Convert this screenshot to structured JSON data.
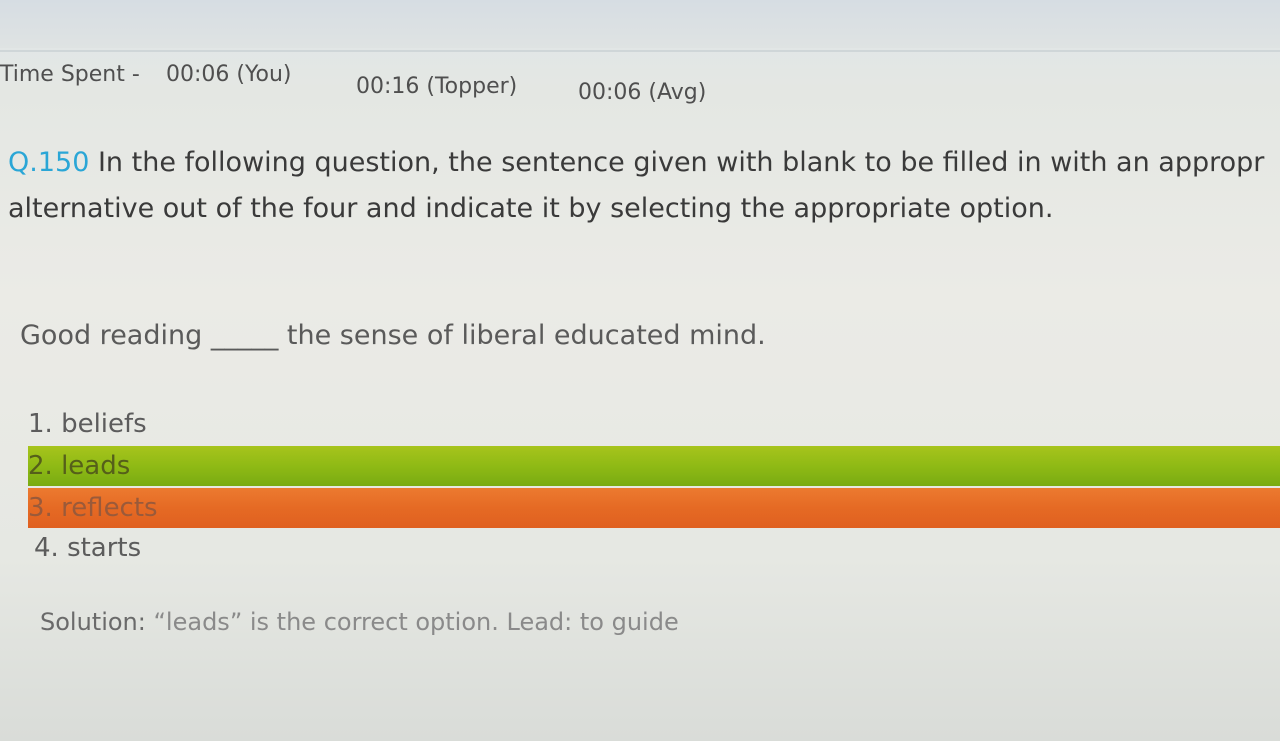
{
  "time_spent": {
    "label": "Time Spent -",
    "you": "00:06 (You)",
    "topper": "00:16 (Topper)",
    "avg": "00:06 (Avg)"
  },
  "question": {
    "number": "Q.150",
    "line1": "In the following question, the sentence given with blank to be filled in with an appropr",
    "line2": "alternative out of the four and indicate it by selecting the appropriate option."
  },
  "sentence": "Good reading _____ the sense of liberal educated mind.",
  "options": [
    {
      "label": "1. beliefs",
      "state": "none"
    },
    {
      "label": "2. leads",
      "state": "correct"
    },
    {
      "label": "3. reflects",
      "state": "wrong"
    },
    {
      "label": "4. starts",
      "state": "none"
    }
  ],
  "solution": {
    "label": "Solution:",
    "text": "“leads” is the correct option. Lead: to guide"
  },
  "colors": {
    "question_number": "#2aa6d6",
    "correct_option": "#8fba15",
    "wrong_option": "#e56a24"
  }
}
